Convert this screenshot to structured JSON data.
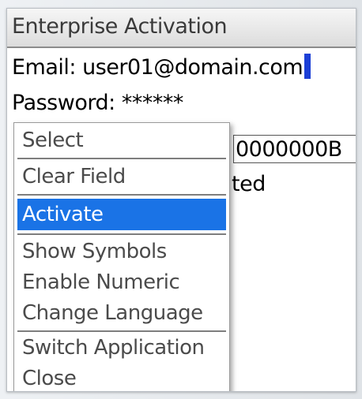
{
  "screen": {
    "title": "Enterprise Activation"
  },
  "form": {
    "email_label": "Email:",
    "email_value": "user01@domain.com",
    "password_label": "Password:",
    "password_value": "******",
    "background_pin_text": "0000000B",
    "background_status_text": "ted"
  },
  "menu": {
    "items": [
      {
        "label": "Select",
        "selected": false
      },
      {
        "label": "Clear Field",
        "selected": false
      },
      {
        "label": "Activate",
        "selected": true
      },
      {
        "label": "Show Symbols",
        "selected": false
      },
      {
        "label": "Enable Numeric",
        "selected": false
      },
      {
        "label": "Change Language",
        "selected": false
      },
      {
        "label": "Switch Application",
        "selected": false
      },
      {
        "label": "Close",
        "selected": false
      }
    ]
  },
  "colors": {
    "selection": "#1a73e6",
    "cursor": "#1c3fd6",
    "menu_text": "#4b4b4b"
  }
}
